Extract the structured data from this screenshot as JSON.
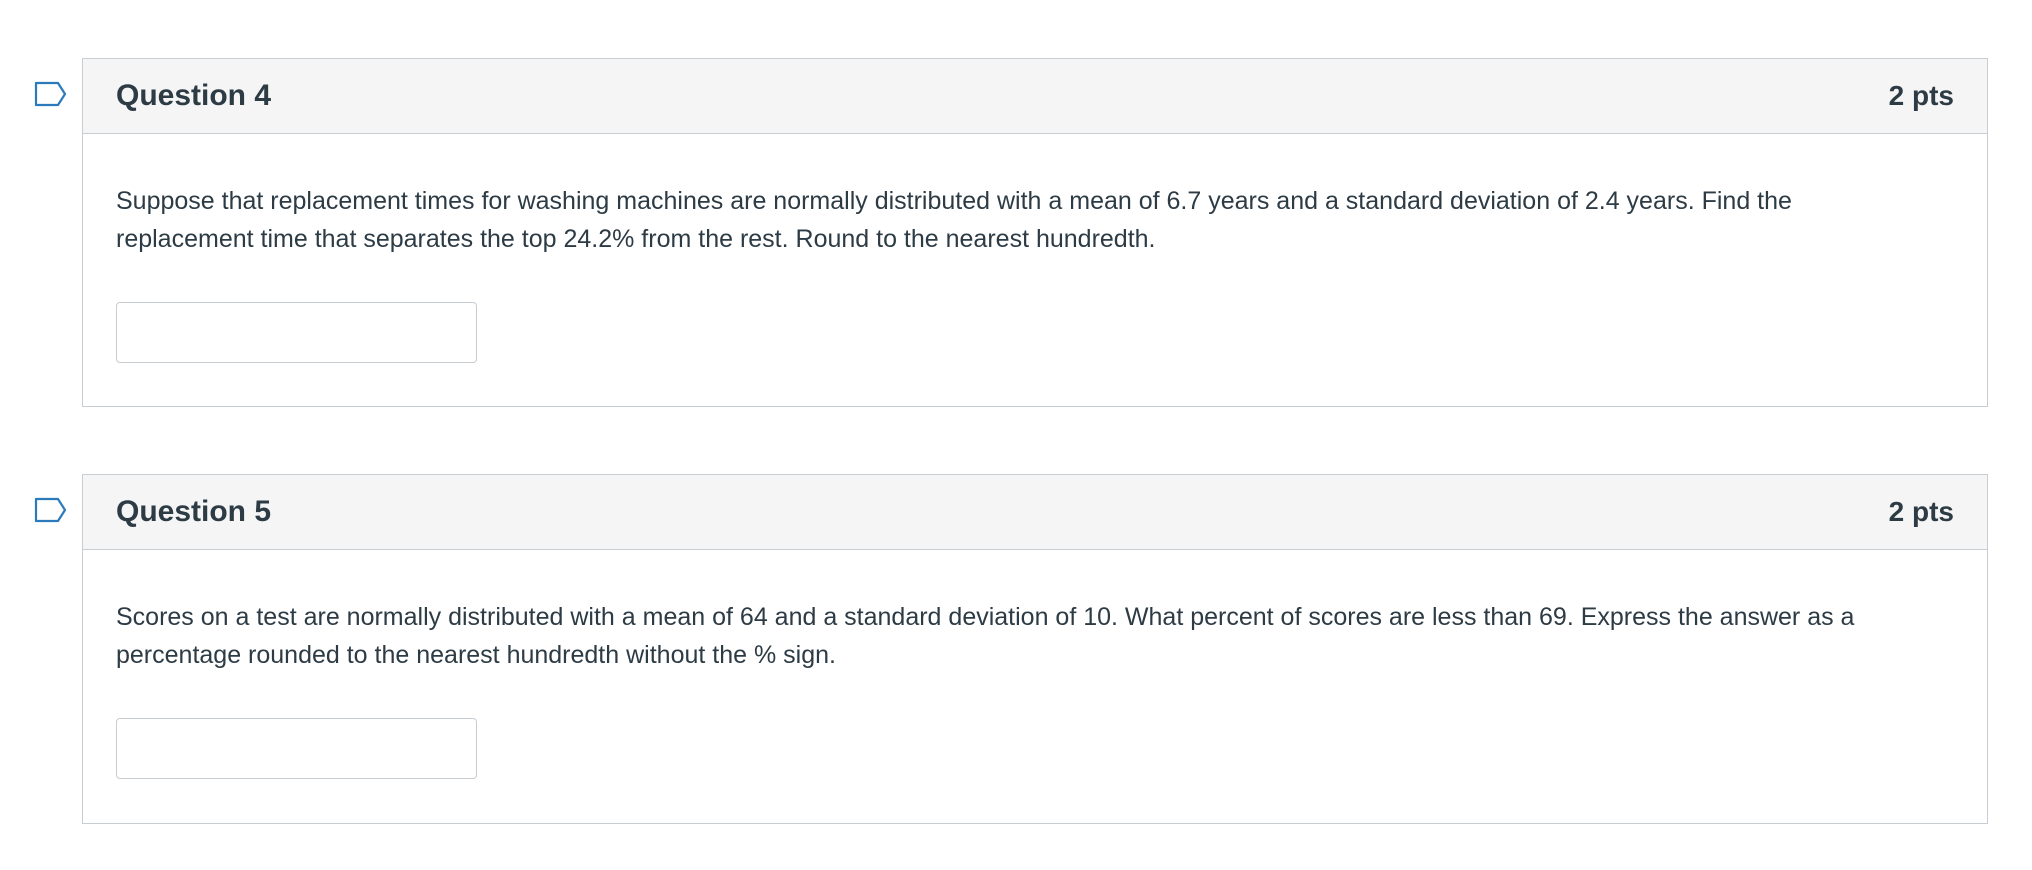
{
  "questions": [
    {
      "title": "Question 4",
      "points": "2 pts",
      "text": "Suppose that replacement times for washing machines are normally distributed with a mean of 6.7 years and a standard deviation of 2.4 years. Find the replacement time that separates the top 24.2% from the rest. Round to the nearest hundredth.",
      "answer_value": "",
      "flag_icon": "flag-question-icon"
    },
    {
      "title": "Question 5",
      "points": "2 pts",
      "text": "Scores on a test are normally distributed with a mean of 64 and a standard deviation of 10. What percent of scores are less than 69. Express the answer as a percentage rounded to the nearest hundredth without the % sign.",
      "answer_value": "",
      "flag_icon": "flag-question-icon"
    }
  ],
  "colors": {
    "header_bg": "#f5f5f5",
    "border": "#c7cdd1",
    "text": "#2d3b45",
    "flag": "#2b7abc"
  }
}
